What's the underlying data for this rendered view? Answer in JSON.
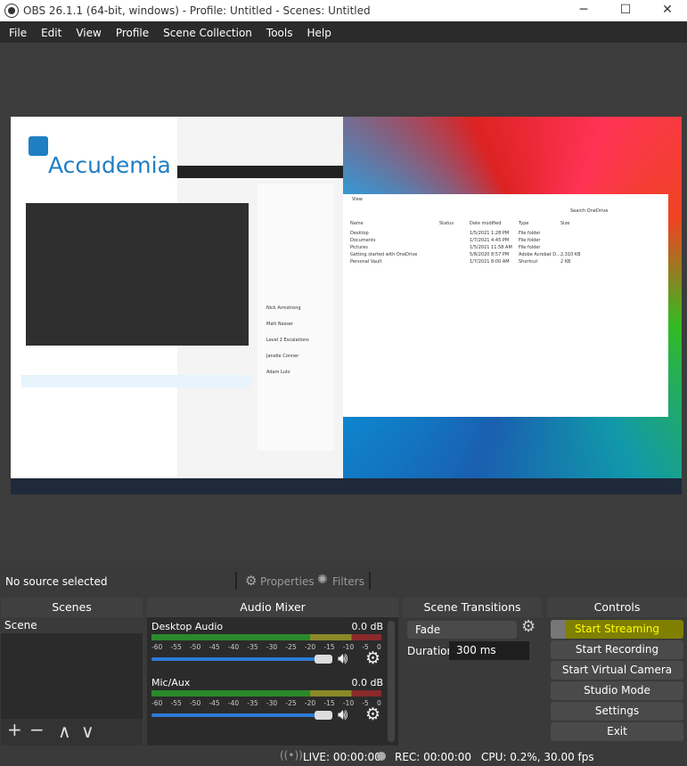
{
  "window": {
    "title": "OBS 26.1.1 (64-bit, windows) - Profile: Untitled - Scenes: Untitled",
    "minimize": "─",
    "maximize": "☐",
    "close": "✕"
  },
  "menu": [
    "File",
    "Edit",
    "View",
    "Profile",
    "Scene Collection",
    "Tools",
    "Help"
  ],
  "preview": {
    "logo_text": "Accudemia",
    "sidebar_people": [
      "Nick Armstrong",
      "Matt Nasser",
      "Level 2 Escalations",
      "Janelle Conner",
      "Adam Lutz"
    ],
    "explorer": {
      "columns": [
        "Name",
        "Status",
        "Date modified",
        "Type",
        "Size"
      ],
      "rows": [
        [
          "Desktop",
          "",
          "1/5/2021 1:28 PM",
          "File folder",
          ""
        ],
        [
          "Documents",
          "",
          "1/7/2021 4:45 PM",
          "File folder",
          ""
        ],
        [
          "Pictures",
          "",
          "1/5/2021 11:58 AM",
          "File folder",
          ""
        ],
        [
          "Getting started with OneDrive",
          "",
          "5/8/2020 8:57 PM",
          "Adobe Acrobat D...",
          "2,310 KB"
        ],
        [
          "Personal Vault",
          "",
          "1/7/2021 8:00 AM",
          "Shortcut",
          "2 KB"
        ]
      ],
      "search": "Search OneDrive",
      "view": "View"
    }
  },
  "source_toolbar": {
    "status": "No source selected",
    "properties": "Properties",
    "filters": "Filters"
  },
  "scenes": {
    "title": "Scenes",
    "items": [
      "Scene"
    ],
    "add": "+",
    "remove": "−",
    "up": "∧",
    "down": "∨"
  },
  "audio_mixer": {
    "title": "Audio Mixer",
    "ticks": [
      "-60",
      "-55",
      "-50",
      "-45",
      "-40",
      "-35",
      "-30",
      "-25",
      "-20",
      "-15",
      "-10",
      "-5",
      "0"
    ],
    "channels": [
      {
        "name": "Desktop Audio",
        "level": "0.0 dB",
        "volume_percent": 100
      },
      {
        "name": "Mic/Aux",
        "level": "0.0 dB",
        "volume_percent": 100
      }
    ]
  },
  "transitions": {
    "title": "Scene Transitions",
    "selected": "Fade",
    "duration_label": "Duration",
    "duration": "300 ms"
  },
  "controls": {
    "title": "Controls",
    "buttons": [
      "Start Streaming",
      "Start Recording",
      "Start Virtual Camera",
      "Studio Mode",
      "Settings",
      "Exit"
    ],
    "highlight_color": "#7f7f00"
  },
  "status": {
    "live": "LIVE: 00:00:00",
    "rec": "REC: 00:00:00",
    "cpu": "CPU: 0.2%, 30.00 fps"
  }
}
